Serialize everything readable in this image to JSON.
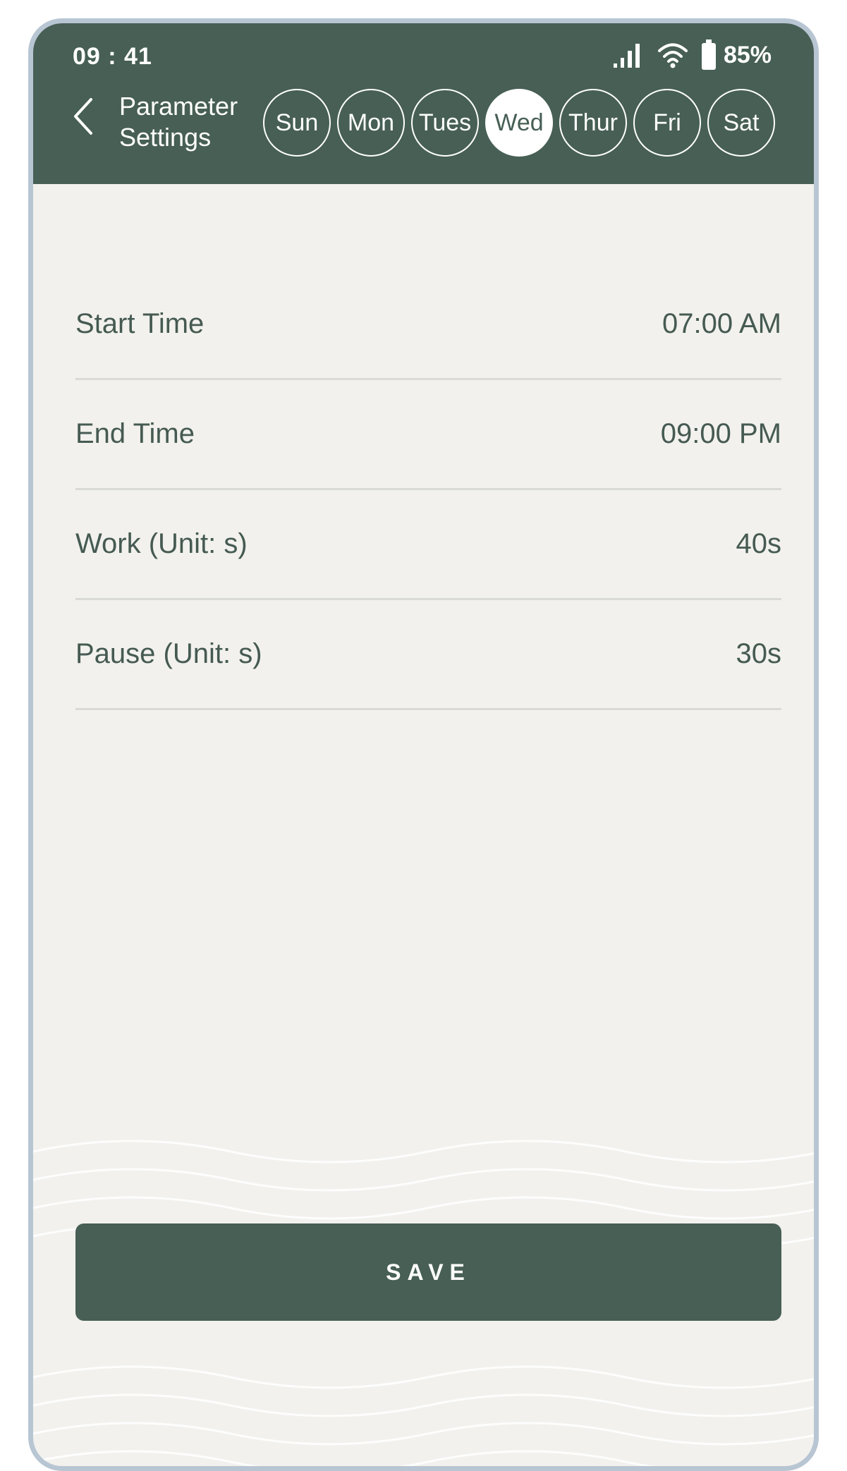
{
  "status_bar": {
    "time": "09 : 41",
    "battery": "85%",
    "icons": [
      "signal-icon",
      "wifi-icon",
      "battery-icon"
    ]
  },
  "header": {
    "back_icon": "chevron-left-icon",
    "title": "Parameter Settings",
    "days": [
      {
        "label": "Sun",
        "active": false
      },
      {
        "label": "Mon",
        "active": false
      },
      {
        "label": "Tues",
        "active": false
      },
      {
        "label": "Wed",
        "active": true
      },
      {
        "label": "Thur",
        "active": false
      },
      {
        "label": "Fri",
        "active": false
      },
      {
        "label": "Sat",
        "active": false
      }
    ]
  },
  "settings": [
    {
      "label": "Start Time",
      "value": "07:00 AM"
    },
    {
      "label": "End Time",
      "value": "09:00 PM"
    },
    {
      "label": "Work (Unit: s)",
      "value": "40s"
    },
    {
      "label": "Pause (Unit: s)",
      "value": "30s"
    }
  ],
  "save_button": {
    "label": "SAVE"
  },
  "colors": {
    "header": "#475f55",
    "background": "#f2f1ed",
    "text": "#455a52",
    "frame": "#b8c6d3"
  }
}
